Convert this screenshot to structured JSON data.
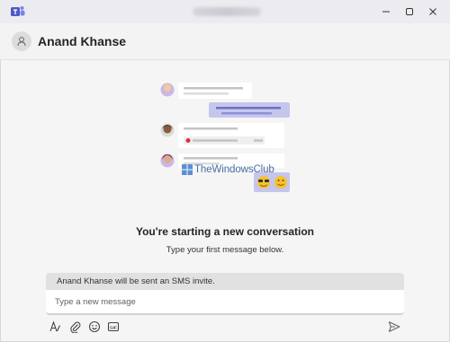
{
  "window": {
    "controls": [
      "minimize-icon",
      "maximize-icon",
      "close-icon"
    ]
  },
  "header": {
    "contact_name": "Anand Khanse",
    "avatar_icon": "person-icon"
  },
  "watermark": {
    "text": "TheWindowsClub"
  },
  "conversation": {
    "heading": "You're starting a new conversation",
    "subheading": "Type your first message below."
  },
  "compose": {
    "sms_notice": "Anand Khanse will be sent an SMS invite.",
    "placeholder": "Type a new message"
  },
  "toolbar": {
    "buttons": [
      "format-icon",
      "attach-icon",
      "emoji-icon",
      "gif-icon"
    ],
    "send_icon": "send-icon"
  },
  "colors": {
    "accent": "#5b5fc7",
    "bubble_purple": "#c5c6ec",
    "background": "#f5f5f5"
  }
}
